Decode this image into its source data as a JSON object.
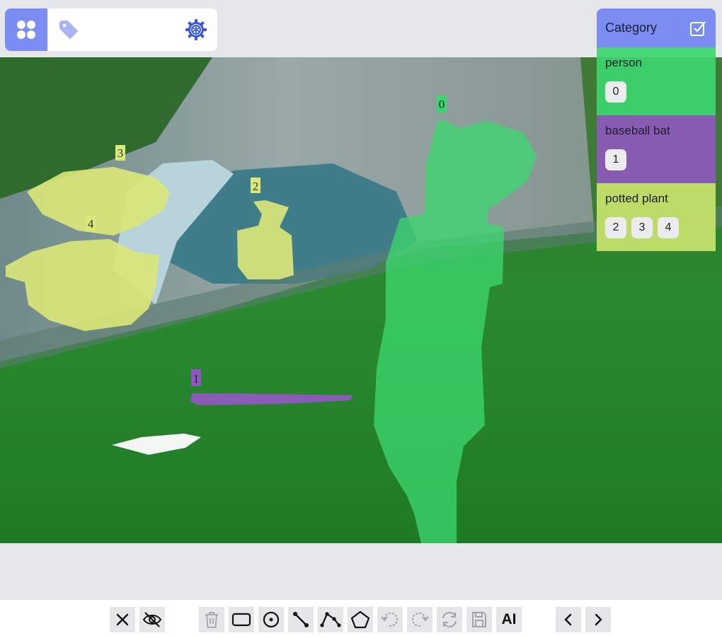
{
  "toolbar_top": {
    "icons": [
      "grid-icon",
      "tag-icon",
      "gear-icon"
    ],
    "accent_color": "#7b8df3"
  },
  "canvas": {
    "annotations": [
      {
        "id": "0",
        "category": "person"
      },
      {
        "id": "1",
        "category": "baseball bat"
      },
      {
        "id": "2",
        "category": "potted plant"
      },
      {
        "id": "3",
        "category": "potted plant"
      },
      {
        "id": "4",
        "category": "potted plant"
      }
    ],
    "colors": {
      "person": "#3cd66e",
      "baseball bat": "#8e58be",
      "potted plant": "#dce878"
    }
  },
  "category_panel": {
    "title": "Category",
    "categories": [
      {
        "name": "person",
        "ids": [
          "0"
        ]
      },
      {
        "name": "baseball bat",
        "ids": [
          "1"
        ]
      },
      {
        "name": "potted plant",
        "ids": [
          "2",
          "3",
          "4"
        ]
      }
    ]
  },
  "bottom_toolbar": {
    "tools": [
      "close-icon",
      "eye-off-icon",
      "trash-icon",
      "rectangle-icon",
      "circle-icon",
      "line-icon",
      "polyline-icon",
      "polygon-icon",
      "undo-icon",
      "redo-icon",
      "refresh-icon",
      "save-icon",
      "AI",
      "chevron-left-icon",
      "chevron-right-icon"
    ],
    "ai_label": "AI"
  }
}
